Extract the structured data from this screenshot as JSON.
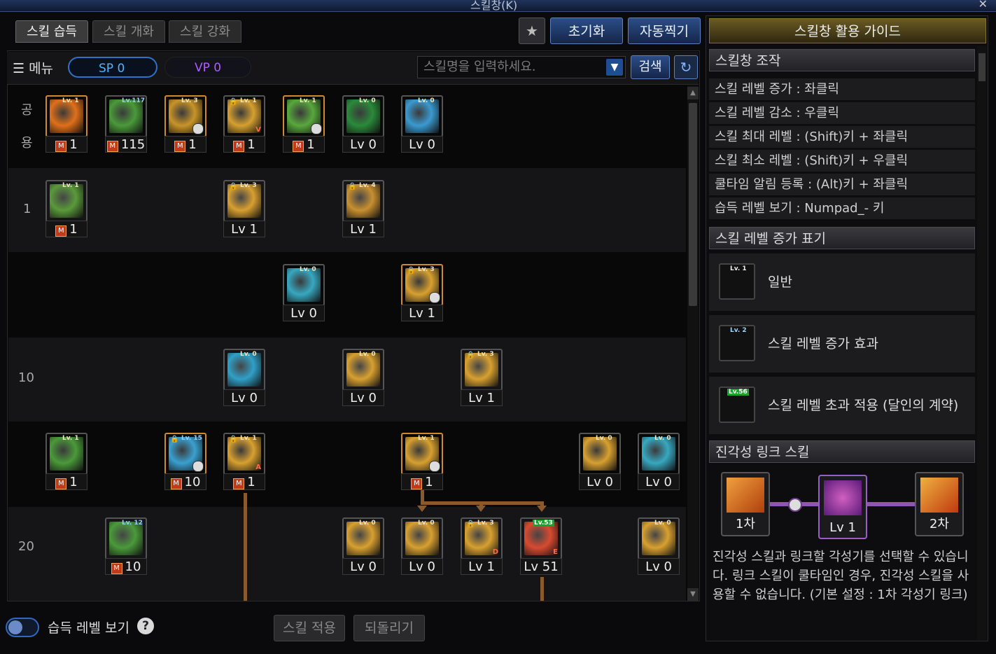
{
  "window": {
    "title": "스킬창(K)",
    "close": "✕",
    "pin": "★"
  },
  "tabs": [
    {
      "label": "스킬 습득"
    },
    {
      "label": "스킬 개화"
    },
    {
      "label": "스킬 강화"
    }
  ],
  "toolbar": {
    "reset_label": "초기화",
    "auto_label": "자동찍기"
  },
  "menubar": {
    "menu_label": "메뉴",
    "sp_label": "SP 0",
    "vp_label": "VP 0",
    "search_placeholder": "스킬명을 입력하세요.",
    "search_button": "검색"
  },
  "row_labels": {
    "common_1": "공",
    "common_2": "용",
    "r1": "1",
    "r10": "10",
    "r20": "20"
  },
  "skills": {
    "c1": {
      "badge": "Lv. 1",
      "foot": "1",
      "mastery": "M",
      "color": "#e0701a"
    },
    "c2": {
      "badge": "Lv.117",
      "foot": "115",
      "mastery": "M",
      "color": "#4a9a3a"
    },
    "c3": {
      "badge": "Lv. 3",
      "foot": "1",
      "mastery": "M",
      "color": "#c89428"
    },
    "c4": {
      "badge": "Lv. 1",
      "foot": "1",
      "mastery": "M",
      "color": "#d6a030",
      "tag": "V"
    },
    "c5": {
      "badge": "Lv. 1",
      "foot": "1",
      "mastery": "M",
      "color": "#58a83c"
    },
    "c6": {
      "badge": "Lv. 0",
      "foot": "Lv 0",
      "color": "#2a8a3a"
    },
    "c7": {
      "badge": "Lv. 0",
      "foot": "Lv 0",
      "color": "#3a9ad0"
    },
    "r1a": {
      "badge": "Lv. 1",
      "foot": "1",
      "mastery": "M",
      "color": "#5a9a3a"
    },
    "r1b": {
      "badge": "Lv. 3",
      "foot": "Lv 1",
      "color": "#d8a030"
    },
    "r1c": {
      "badge": "Lv. 4",
      "foot": "Lv 1",
      "color": "#c89030"
    },
    "r2a": {
      "badge": "Lv. 0",
      "foot": "Lv 0",
      "color": "#38a8c0"
    },
    "r2b": {
      "badge": "Lv. 3",
      "foot": "Lv 1",
      "color": "#d8a030"
    },
    "r10a": {
      "badge": "Lv. 0",
      "foot": "Lv 0",
      "color": "#30a0c8"
    },
    "r10b": {
      "badge": "Lv. 0",
      "foot": "Lv 0",
      "color": "#d8a030"
    },
    "r10c": {
      "badge": "Lv. 3",
      "foot": "Lv 1",
      "color": "#d8a030"
    },
    "r15a": {
      "badge": "Lv. 1",
      "foot": "1",
      "mastery": "M",
      "color": "#4a9a3a"
    },
    "r15b": {
      "badge": "Lv. 15",
      "foot": "10",
      "mastery": "M",
      "color": "#3aa0d0"
    },
    "r15c": {
      "badge": "Lv. 1",
      "foot": "1",
      "mastery": "M",
      "color": "#d8a030",
      "tag": "A"
    },
    "r15d": {
      "badge": "Lv. 1",
      "foot": "1",
      "mastery": "M",
      "color": "#d8a030"
    },
    "r15e": {
      "badge": "Lv. 0",
      "foot": "Lv 0",
      "color": "#d8a030"
    },
    "r15f": {
      "badge": "Lv. 0",
      "foot": "Lv 0",
      "color": "#38a8c0"
    },
    "r20a": {
      "badge": "Lv. 12",
      "foot": "10",
      "mastery": "M",
      "color": "#4a9a3a"
    },
    "r20b": {
      "badge": "Lv. 0",
      "foot": "Lv 0",
      "color": "#d8a030"
    },
    "r20c": {
      "badge": "Lv. 0",
      "foot": "Lv 0",
      "color": "#d8a030"
    },
    "r20d": {
      "badge": "Lv. 3",
      "foot": "Lv 1",
      "color": "#d8a030",
      "tag": "D"
    },
    "r20e": {
      "badge": "Lv.53",
      "foot": "Lv 51",
      "color": "#d84a30",
      "tag": "E"
    },
    "r20f": {
      "badge": "Lv. 0",
      "foot": "Lv 0",
      "color": "#d8a030"
    }
  },
  "bottom": {
    "acquire_label": "습득 레벨 보기",
    "help": "?",
    "apply_label": "스킬 적용",
    "revert_label": "되돌리기"
  },
  "guide": {
    "title": "스킬창 활용 가이드",
    "section_control": "스킬창 조작",
    "items": [
      "스킬 레벨 증가 : 좌클릭",
      "스킬 레벨 감소 : 우클릭",
      "스킬 최대 레벨 : (Shift)키 + 좌클릭",
      "스킬 최소 레벨 : (Shift)키 + 우클릭",
      "쿨타임 알림 등록 : (Alt)키 + 좌클릭",
      "습득 레벨 보기 : Numpad_- 키"
    ],
    "section_level": "스킬 레벨 증가 표기",
    "level_normal_badge": "Lv. 1",
    "level_normal": "일반",
    "level_bonus_badge": "Lv. 2",
    "level_bonus": "스킬 레벨 증가 효과",
    "level_over_badge": "Lv.56",
    "level_over": "스킬 레벨 초과 적용 (달인의 계약)",
    "section_link": "진각성 링크 스킬",
    "link_first": "1차",
    "link_mid": "Lv 1",
    "link_second": "2차",
    "link_desc": "진각성 스킬과 링크할 각성기를 선택할 수 있습니다. 링크 스킬이 쿨타임인 경우, 진각성 스킬을 사용할 수 없습니다. (기본 설정 : 1차 각성기 링크)"
  }
}
